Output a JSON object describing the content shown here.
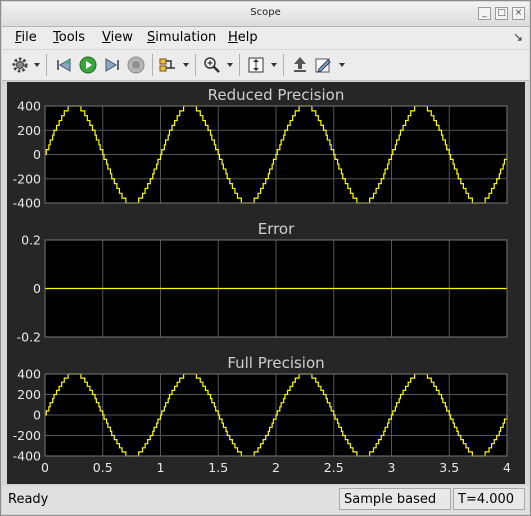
{
  "window": {
    "title": "Scope"
  },
  "menu": [
    {
      "label": "File",
      "mnemonic": "F",
      "rest": "ile"
    },
    {
      "label": "Tools",
      "mnemonic": "T",
      "rest": "ools"
    },
    {
      "label": "View",
      "mnemonic": "V",
      "rest": "iew"
    },
    {
      "label": "Simulation",
      "mnemonic": "S",
      "rest": "imulation"
    },
    {
      "label": "Help",
      "mnemonic": "H",
      "rest": "elp"
    }
  ],
  "toolbar": {
    "icons": [
      "gear-icon",
      "step-back-icon",
      "run-icon",
      "step-forward-icon",
      "stop-icon",
      "highlight-signal-icon",
      "zoom-icon",
      "autoscale-icon",
      "bring-to-front-icon",
      "edit-style-icon"
    ]
  },
  "colors": {
    "background": "#262626",
    "axes": "#000000",
    "grid": "#555555",
    "trace": "#ffff00",
    "text": "#cfcfcf"
  },
  "chart_data": [
    {
      "type": "line",
      "title": "Reduced Precision",
      "ylim": [
        -400,
        400
      ],
      "yticks": [
        "400",
        "200",
        "0",
        "-200",
        "-400"
      ],
      "xlim": [
        0,
        4
      ],
      "series": [
        {
          "amplitude": 400,
          "frequency_hz": 1,
          "quantized": true
        }
      ]
    },
    {
      "type": "line",
      "title": "Error",
      "ylim": [
        -0.2,
        0.2
      ],
      "yticks": [
        "0.2",
        "0",
        "-0.2"
      ],
      "xlim": [
        0,
        4
      ],
      "series": [
        {
          "constant": 0
        }
      ]
    },
    {
      "type": "line",
      "title": "Full Precision",
      "ylim": [
        -400,
        400
      ],
      "yticks": [
        "400",
        "200",
        "0",
        "-200",
        "-400"
      ],
      "xlim": [
        0,
        4
      ],
      "xticks": [
        "0",
        "0.5",
        "1",
        "1.5",
        "2",
        "2.5",
        "3",
        "3.5",
        "4"
      ],
      "series": [
        {
          "amplitude": 400,
          "frequency_hz": 1,
          "quantized": true
        }
      ]
    }
  ],
  "status": {
    "state": "Ready",
    "mode": "Sample based",
    "time": "T=4.000"
  }
}
